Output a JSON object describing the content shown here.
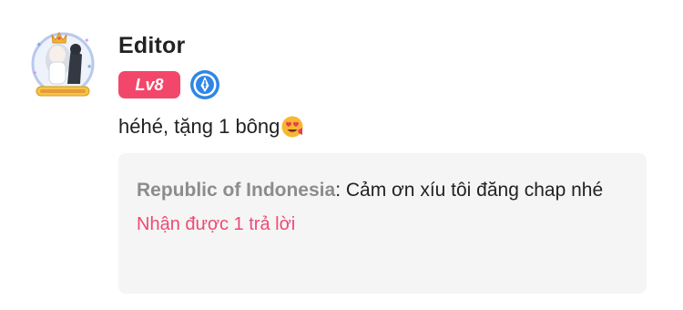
{
  "comment": {
    "username": "Editor",
    "level_label": "Lv8",
    "role_badge_icon": "quill-pen-icon",
    "text": "héhé, tặng 1 bông",
    "emoji": "heart-eyes-emoji",
    "reply": {
      "author": "Republic of Indonesia",
      "separator": ":",
      "text": " Cảm ơn xíu tôi đăng chap nhé",
      "reply_count_label": "Nhận được 1 trả lời"
    }
  },
  "colors": {
    "level_badge": "#f2476a",
    "role_badge": "#2f86e6",
    "reply_link": "#ee4a74",
    "reply_author": "#8c8c8c",
    "reply_background": "#f5f5f5"
  }
}
